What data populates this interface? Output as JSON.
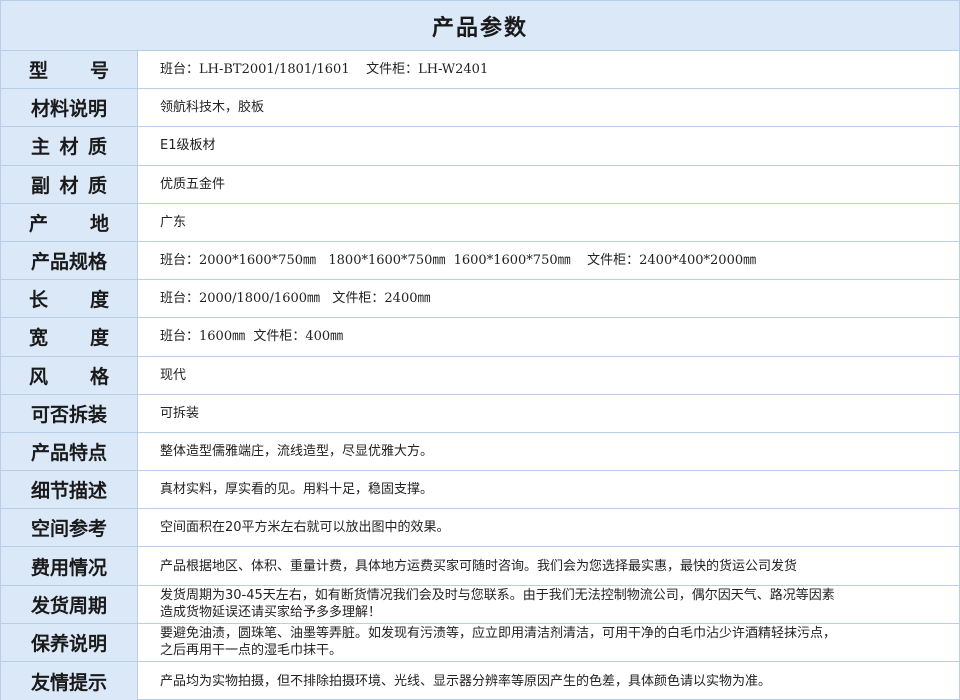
{
  "header": {
    "title": "产品参数"
  },
  "rows": [
    {
      "label": [
        "型",
        "号"
      ],
      "value": "班台：LH-BT2001/1801/1601    文件柜：LH-W2401"
    },
    {
      "label": [
        "材料说明"
      ],
      "value": "领航科技木，胶板"
    },
    {
      "label": [
        "主",
        "材",
        "质"
      ],
      "value": "E1级板材"
    },
    {
      "label": [
        "副",
        "材",
        "质"
      ],
      "value": "优质五金件"
    },
    {
      "label": [
        "产",
        "地"
      ],
      "value": "广东"
    },
    {
      "label": [
        "产品规格"
      ],
      "value": "班台：2000*1600*750㎜   1800*1600*750㎜  1600*1600*750㎜    文件柜：2400*400*2000㎜"
    },
    {
      "label": [
        "长",
        "度"
      ],
      "value": "班台：2000/1800/1600㎜   文件柜：2400㎜"
    },
    {
      "label": [
        "宽",
        "度"
      ],
      "value": "班台：1600㎜  文件柜：400㎜"
    },
    {
      "label": [
        "风",
        "格"
      ],
      "value": "现代"
    },
    {
      "label": [
        "可否拆装"
      ],
      "value": "可拆装"
    },
    {
      "label": [
        "产品特点"
      ],
      "value": "整体造型儒雅端庄，流线造型，尽显优雅大方。"
    },
    {
      "label": [
        "细节描述"
      ],
      "value": "真材实料，厚实看的见。用料十足，稳固支撑。"
    },
    {
      "label": [
        "空间参考"
      ],
      "value": "空间面积在20平方米左右就可以放出图中的效果。"
    },
    {
      "label": [
        "费用情况"
      ],
      "value": "产品根据地区、体积、重量计费，具体地方运费买家可随时咨询。我们会为您选择最实惠，最快的货运公司发货"
    },
    {
      "label": [
        "发货周期"
      ],
      "value": "发货周期为30-45天左右，如有断货情况我们会及时与您联系。由于我们无法控制物流公司，偶尔因天气、路况等因素\n造成货物延误还请买家给予多多理解！"
    },
    {
      "label": [
        "保养说明"
      ],
      "value": "要避免油渍，圆珠笔、油墨等弄脏。如发现有污渍等，应立即用清洁剂清洁，可用干净的白毛巾沾少许酒精轻抹污点，\n之后再用干一点的湿毛巾抹干。"
    },
    {
      "label": [
        "友情提示"
      ],
      "value": "产品均为实物拍摄，但不排除拍摄环境、光线、显示器分辨率等原因产生的色差，具体颜色请以实物为准。"
    }
  ]
}
